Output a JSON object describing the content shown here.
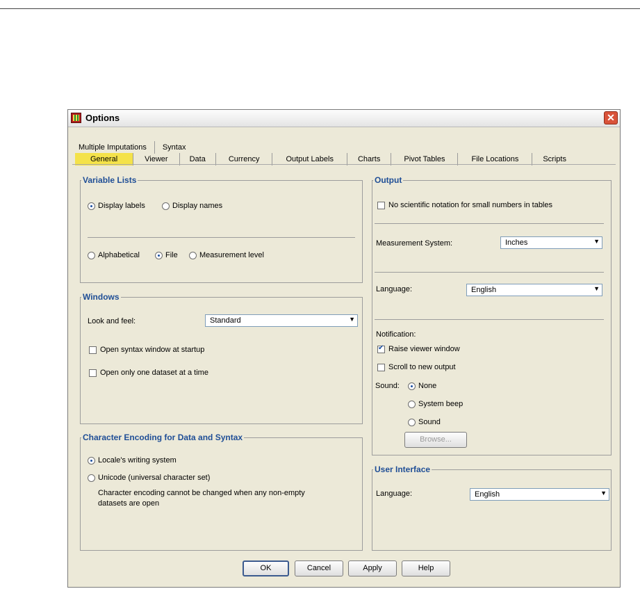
{
  "window": {
    "title": "Options",
    "close_label": "✕"
  },
  "tabs": {
    "row1": [
      "Multiple Imputations",
      "Syntax"
    ],
    "row2": [
      "General",
      "Viewer",
      "Data",
      "Currency",
      "Output Labels",
      "Charts",
      "Pivot Tables",
      "File Locations",
      "Scripts"
    ],
    "active": "General"
  },
  "variable_lists": {
    "legend": "Variable Lists",
    "display_labels": "Display labels",
    "display_names": "Display names",
    "alphabetical": "Alphabetical",
    "file": "File",
    "measurement_level": "Measurement level"
  },
  "windows": {
    "legend": "Windows",
    "look_label": "Look and feel:",
    "look_value": "Standard",
    "open_syntax": "Open syntax window at startup",
    "open_one_dataset": "Open only one dataset at a time"
  },
  "encoding": {
    "legend": "Character Encoding for Data and Syntax",
    "locale": "Locale's writing system",
    "unicode": "Unicode (universal character set)",
    "note": "Character encoding cannot be changed when any non-empty datasets are open"
  },
  "output": {
    "legend": "Output",
    "no_sci": "No scientific notation for small numbers in tables",
    "measurement_label": "Measurement System:",
    "measurement_value": "Inches",
    "language_label": "Language:",
    "language_value": "English",
    "notification_label": "Notification:",
    "raise_viewer": "Raise viewer window",
    "scroll_new": "Scroll to new output",
    "sound_label": "Sound:",
    "sound_none": "None",
    "sound_system": "System beep",
    "sound_sound": "Sound",
    "browse": "Browse..."
  },
  "user_interface": {
    "legend": "User Interface",
    "language_label": "Language:",
    "language_value": "English"
  },
  "buttons": {
    "ok": "OK",
    "cancel": "Cancel",
    "apply": "Apply",
    "help": "Help"
  }
}
